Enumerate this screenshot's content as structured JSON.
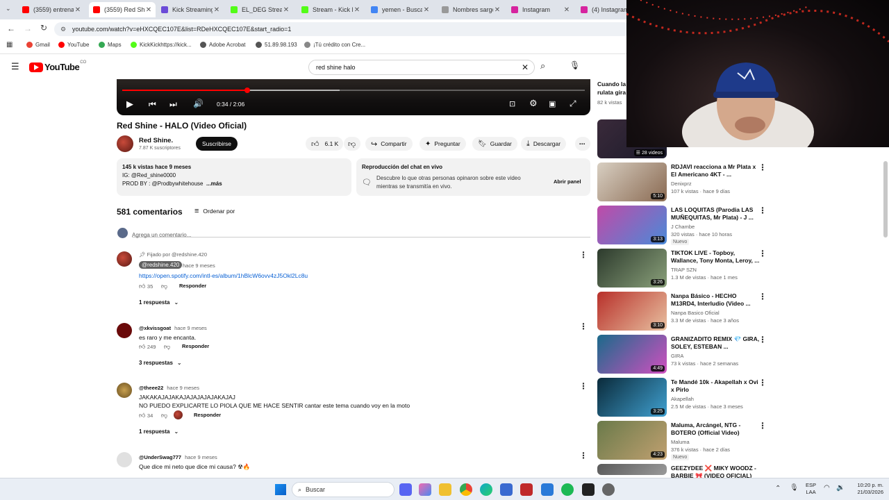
{
  "browser": {
    "tabs": [
      {
        "label": "(3559) entrena",
        "color": "#ff0000",
        "active": false
      },
      {
        "label": "(3559) Red Shi",
        "color": "#ff0000",
        "active": true
      },
      {
        "label": "Kick Streaming",
        "color": "#6b4bd8",
        "active": false
      },
      {
        "label": "EL_DEG Stream",
        "color": "#53fc18",
        "active": false
      },
      {
        "label": "Stream - Kick D",
        "color": "#53fc18",
        "active": false
      },
      {
        "label": "yemen - Busca",
        "color": "#4285f4",
        "active": false
      },
      {
        "label": "Nombres sargo",
        "color": "#999999",
        "active": false
      },
      {
        "label": "Instagram",
        "color": "#d6249f",
        "active": false
      },
      {
        "label": "(4) Instagram",
        "color": "#d6249f",
        "active": false
      }
    ],
    "url": "youtube.com/watch?v=eHXCQEC107E&list=RDeHXCQEC107E&start_radio=1",
    "bookmarks": [
      {
        "label": "Gmail",
        "color": "#ea4335"
      },
      {
        "label": "YouTube",
        "color": "#ff0000"
      },
      {
        "label": "Maps",
        "color": "#34a853"
      },
      {
        "label": "KickKickhttps://kick...",
        "color": "#53fc18"
      },
      {
        "label": "Adobe Acrobat",
        "color": "#555555"
      },
      {
        "label": "51.89.98.193",
        "color": "#555555"
      },
      {
        "label": "¡Tú crédito con Cre...",
        "color": "#888888"
      }
    ]
  },
  "youtube": {
    "logo_text": "YouTube",
    "logo_region": "CO",
    "search_query": "red shine halo",
    "player": {
      "time": "0:34 / 2:06",
      "progress": 0.27,
      "buffered": 0.47
    },
    "video": {
      "title": "Red Shine - HALO (Video Oficial)",
      "channel": "Red Shine.",
      "subscribers": "7.87 K suscriptores",
      "subscribe_label": "Suscribirse",
      "likes": "6.1 K",
      "share": "Compartir",
      "ask": "Preguntar",
      "save": "Guardar",
      "download": "Descargar"
    },
    "description": {
      "stats": "145 k vistas  hace 9 meses",
      "line1": "IG: @Red_shine0000",
      "line2": "PROD BY : @Prodbywhitehouse",
      "more": "...más"
    },
    "chat": {
      "title": "Reproducción del chat en vivo",
      "text_line1": "Descubre lo que otras personas opinaron sobre este video",
      "text_line2": "mientras se transmitía en vivo.",
      "button": "Abrir panel"
    },
    "comments_header": {
      "count": "581 comentarios",
      "sort": "Ordenar por",
      "placeholder": "Agrega un comentario..."
    },
    "comments": [
      {
        "pinned": "Fijado por @redshine.420",
        "author": "@redshine.420",
        "time": "hace 9 meses",
        "text1": "https://open.spotify.com/intl-es/album/1hBlcW6ovv4zJ5Okl2Lc8u",
        "text2": "",
        "likes": "35",
        "reply": "Responder",
        "replies": "1 respuesta"
      },
      {
        "pinned": "",
        "author": "@xkvissgoat",
        "time": "hace 9 meses",
        "text1": "es raro y me encanta.",
        "text2": "",
        "likes": "249",
        "reply": "Responder",
        "replies": "3 respuestas"
      },
      {
        "pinned": "",
        "author": "@theee22",
        "time": "hace 9 meses",
        "text1": "JAKAKAJAJAKAJAJAJAJAJAKAJAJ",
        "text2": "NO PUEDO EXPLICARTE LO PIOLA QUE ME HACE SENTIR cantar este tema cuando voy en la moto",
        "likes": "34",
        "reply": "Responder",
        "replies": "1 respuesta"
      },
      {
        "pinned": "",
        "author": "@UnderSwag777",
        "time": "hace 9 meses",
        "text1": "Que dice mi neto que dice mi causa? ☢🔥",
        "text2": "",
        "likes": "",
        "reply": "",
        "replies": ""
      }
    ],
    "sidebar_top": {
      "line1": "Cuando la",
      "line2": "rulata gira",
      "line3": "82 k vistas",
      "playlist_count": "28 videos"
    },
    "recommendations": [
      {
        "title": "RDJAVI reacciona a Mr Plata x El Americano 4KT - ...",
        "channel": "Denixprz",
        "stats": "107 k vistas · hace 9 días",
        "duration": "5:10",
        "badge": "",
        "colors": [
          "#d8cfc2",
          "#8a6a52"
        ]
      },
      {
        "title": "LAS LOQUITAS (Parodia LAS MUÑEQUITAS, Mr Plata) - J ...",
        "channel": "J Chambe",
        "stats": "320 vistas · hace 10 horas",
        "duration": "3:13",
        "badge": "Nuevo",
        "colors": [
          "#c04aa8",
          "#4a8ad8"
        ]
      },
      {
        "title": "TIKTOK LIVE - Topboy, Wallance, Tony Monta, Leroy, ...",
        "channel": "TRAP SZN",
        "stats": "1.3 M de vistas · hace 1 mes",
        "duration": "3:26",
        "badge": "",
        "colors": [
          "#2c3a2c",
          "#8aa07a"
        ]
      },
      {
        "title": "Nanpa Básico - HECHO M13RD4, Interludio (Video ...",
        "channel": "Nanpa Basico Oficial",
        "stats": "3.3 M de vistas · hace 3 años",
        "duration": "3:10",
        "badge": "",
        "colors": [
          "#b8302a",
          "#e8c0a0"
        ]
      },
      {
        "title": "GRANIZADITO REMIX 💎 GIRA, SOLEY, ESTEBAN ...",
        "channel": "GIRA",
        "stats": "73 k vistas · hace 2 semanas",
        "duration": "4:49",
        "badge": "",
        "colors": [
          "#1a6a8a",
          "#d050c0"
        ]
      },
      {
        "title": "Te Mandé 10k - Akapellah x Ovi x Pirlo",
        "channel": "Akapellah",
        "stats": "2.5 M de vistas · hace 3 meses",
        "duration": "3:25",
        "badge": "",
        "colors": [
          "#0a2a3a",
          "#40a0d0"
        ]
      },
      {
        "title": "Maluma, Arcángel, NTG - BOTERO (Official Video)",
        "channel": "Maluma",
        "stats": "376 k vistas · hace 2 días",
        "duration": "4:23",
        "badge": "Nuevo",
        "colors": [
          "#6a7a4a",
          "#c0a070"
        ]
      },
      {
        "title": "GEEZYDEE ❌ MIKY WOODZ - BARBIE 🎀 (VIDEO OFICIAL)",
        "channel": "",
        "stats": "",
        "duration": "",
        "badge": "",
        "colors": [
          "#5a5a5a",
          "#9a9a9a"
        ]
      }
    ]
  },
  "taskbar": {
    "search": "Buscar",
    "lang1": "ESP",
    "lang2": "LAA",
    "time": "10:20 p. m.",
    "date": "21/03/2026"
  },
  "colors": {
    "accent": "#ff0000",
    "subscribe_bg": "#0f0f0f",
    "link": "#065fd4"
  }
}
